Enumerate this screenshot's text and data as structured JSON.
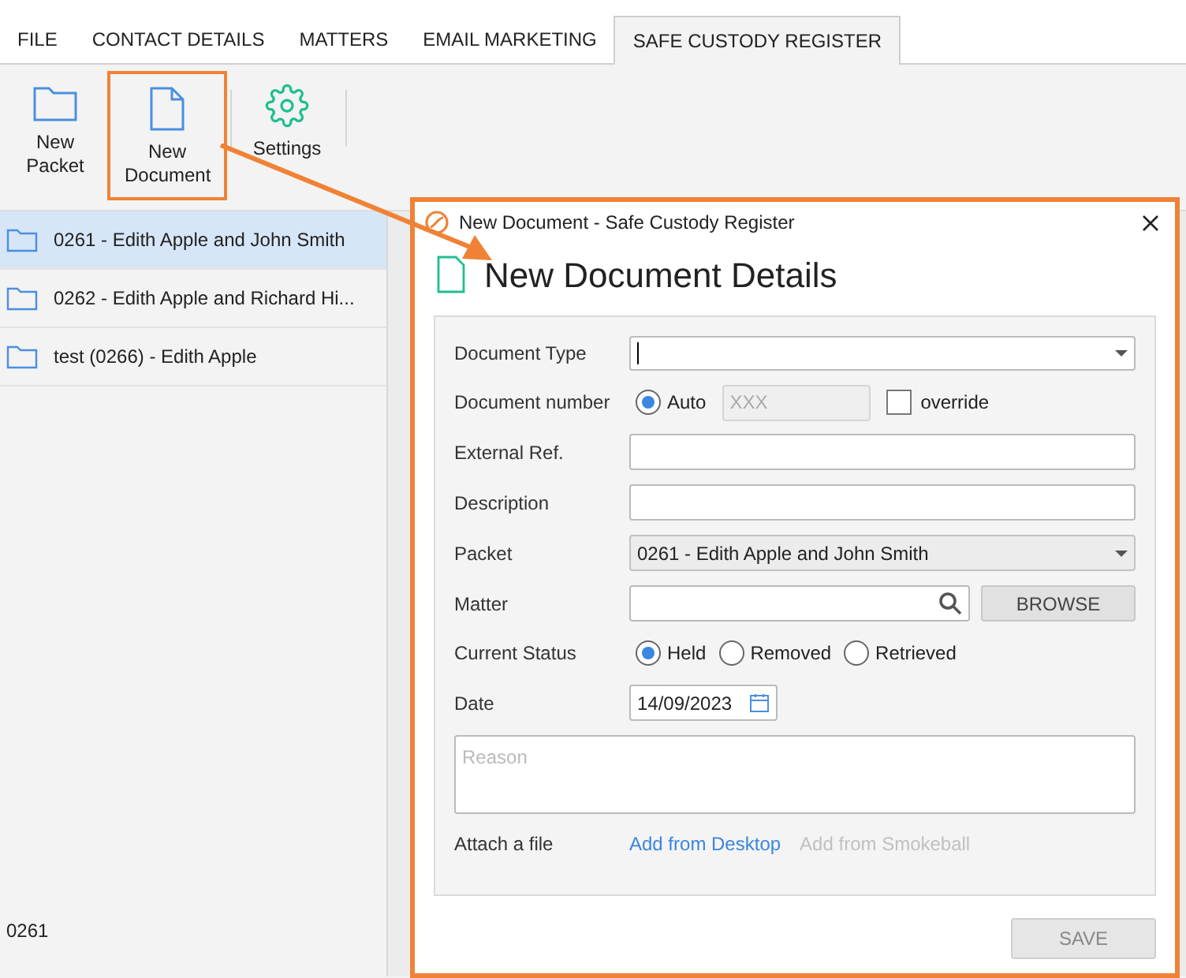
{
  "tabs": [
    {
      "label": "FILE",
      "selected": false
    },
    {
      "label": "CONTACT DETAILS",
      "selected": false
    },
    {
      "label": "MATTERS",
      "selected": false
    },
    {
      "label": "EMAIL MARKETING",
      "selected": false
    },
    {
      "label": "SAFE CUSTODY REGISTER",
      "selected": true
    }
  ],
  "ribbon": [
    {
      "kind": "folder",
      "label": "New Packet",
      "highlighted": false
    },
    {
      "kind": "document",
      "label": "New Document",
      "highlighted": true
    },
    {
      "kind": "gear",
      "label": "Settings",
      "highlighted": false
    }
  ],
  "packets": [
    {
      "label": "0261  -  Edith Apple and John Smith",
      "selected": true
    },
    {
      "label": "0262  -  Edith Apple and Richard Hi...",
      "selected": false
    },
    {
      "label": "test (0266)  -  Edith Apple",
      "selected": false
    }
  ],
  "details": {
    "number": "0261"
  },
  "dialog": {
    "title": "New Document - Safe Custody Register",
    "heading": "New Document Details",
    "document_type": {
      "label": "Document Type"
    },
    "document_number": {
      "label": "Document number",
      "auto_label": "Auto",
      "auto": true,
      "placeholder": "XXX",
      "override_label": "override",
      "override": false
    },
    "external_ref": {
      "label": "External Ref."
    },
    "description": {
      "label": "Description"
    },
    "packet": {
      "label": "Packet",
      "value": "0261 - Edith Apple and John Smith"
    },
    "matter": {
      "label": "Matter",
      "browse": "BROWSE"
    },
    "status": {
      "label": "Current Status",
      "options": [
        {
          "label": "Held",
          "selected": true
        },
        {
          "label": "Removed",
          "selected": false
        },
        {
          "label": "Retrieved",
          "selected": false
        }
      ]
    },
    "date": {
      "label": "Date",
      "value": "14/09/2023"
    },
    "reason": {
      "placeholder": "Reason"
    },
    "attach": {
      "label": "Attach a file",
      "links": [
        {
          "label": "Add from Desktop",
          "disabled": false
        },
        {
          "label": "Add from Smokeball",
          "disabled": true
        }
      ]
    },
    "save": {
      "label": "SAVE",
      "disabled": true
    }
  }
}
